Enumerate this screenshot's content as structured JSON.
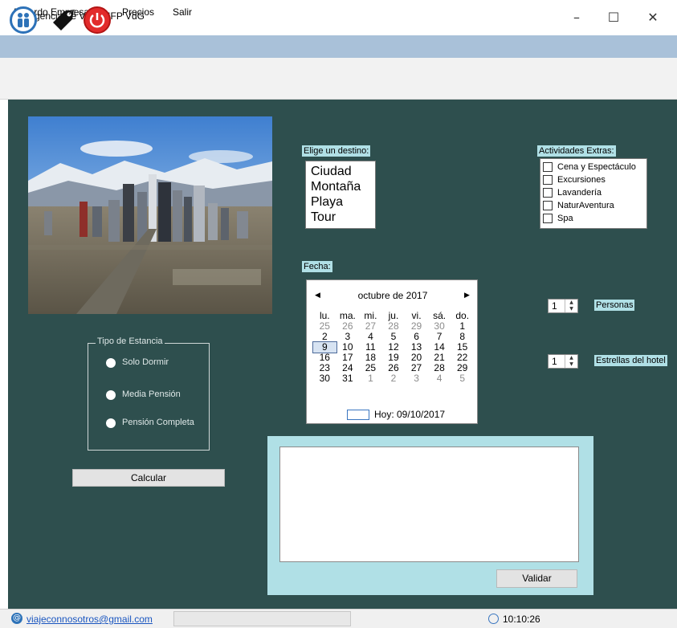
{
  "window": {
    "title": "Agencia de Viajes IFP VdG",
    "minimize": "–",
    "maximize": "☐",
    "close": "✕"
  },
  "menu": {
    "items": [
      "Acuerdo Empresa",
      "Precios",
      "Salir"
    ]
  },
  "toolbar": {
    "icons": [
      "people-icon",
      "price-tag-icon",
      "power-icon"
    ]
  },
  "estancia": {
    "legend": "Tipo de Estancia",
    "options": [
      "Solo Dormir",
      "Media Pensión",
      "Pensión Completa"
    ]
  },
  "calcular_label": "Calcular",
  "destino": {
    "label": "Elige un destino:",
    "items": [
      "Ciudad",
      "Montaña",
      "Playa",
      "Tour"
    ]
  },
  "fecha": {
    "label": "Fecha:",
    "month": "octubre de 2017",
    "weekdays": [
      "lu.",
      "ma.",
      "mi.",
      "ju.",
      "vi.",
      "sá.",
      "do."
    ],
    "weeks": [
      [
        "25",
        "26",
        "27",
        "28",
        "29",
        "30",
        "1"
      ],
      [
        "2",
        "3",
        "4",
        "5",
        "6",
        "7",
        "8"
      ],
      [
        "9",
        "10",
        "11",
        "12",
        "13",
        "14",
        "15"
      ],
      [
        "16",
        "17",
        "18",
        "19",
        "20",
        "21",
        "22"
      ],
      [
        "23",
        "24",
        "25",
        "26",
        "27",
        "28",
        "29"
      ],
      [
        "30",
        "31",
        "1",
        "2",
        "3",
        "4",
        "5"
      ]
    ],
    "selected": "9",
    "today": "Hoy: 09/10/2017"
  },
  "actividades": {
    "label": "Actividades Extras:",
    "items": [
      "Cena y Espectáculo",
      "Excursiones",
      "Lavandería",
      "NaturAventura",
      "Spa"
    ]
  },
  "personas": {
    "value": "1",
    "label": "Personas"
  },
  "estrellas": {
    "value": "1",
    "label": "Estrellas del hotel"
  },
  "validar_label": "Validar",
  "status": {
    "email": "viajeconnosotros@gmail.com",
    "time": "10:10:26"
  },
  "colors": {
    "panel": "#2e4f4e",
    "menu": "#a9c1d9",
    "label_bg": "#b0e0e6",
    "result_panel": "#b0e0e6"
  }
}
